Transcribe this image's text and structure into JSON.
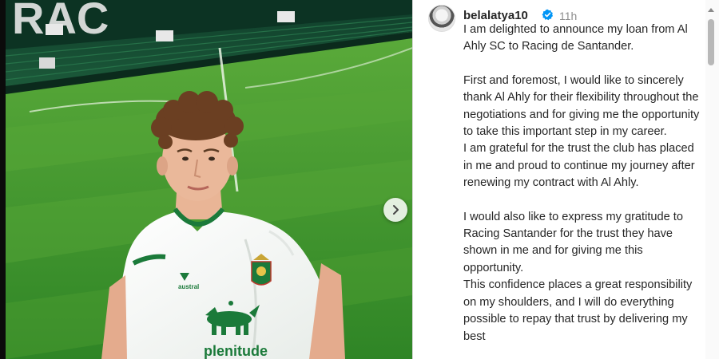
{
  "post": {
    "username": "belalatya10",
    "time": "11h",
    "verified": true,
    "caption_paragraphs": [
      "I am delighted to announce my loan from Al Ahly SC to Racing de Santander.",
      "First and foremost, I would like to sincerely thank Al Ahly for their flexibility throughout the negotiations and for giving me the opportunity to take this important step in my career.\nI am grateful for the trust the club has placed in me and proud to continue my journey after renewing my contract with Al Ahly.",
      "I would also like to express my gratitude to Racing Santander for the trust they have shown in me and for giving me this opportunity.\nThis confidence places a great responsibility on my shoulders, and I will do everything possible to repay that trust by delivering my best"
    ]
  },
  "media": {
    "stadium_letters": "RAC",
    "jersey_brand": "austral",
    "jersey_sponsor": "plenitude"
  },
  "icons": {
    "next": "chevron-right-icon",
    "verified": "verified-badge-icon"
  },
  "colors": {
    "verified_blue": "#0095f6",
    "jersey_green": "#1b7a3a",
    "pitch_green": "#3f9b2e"
  }
}
